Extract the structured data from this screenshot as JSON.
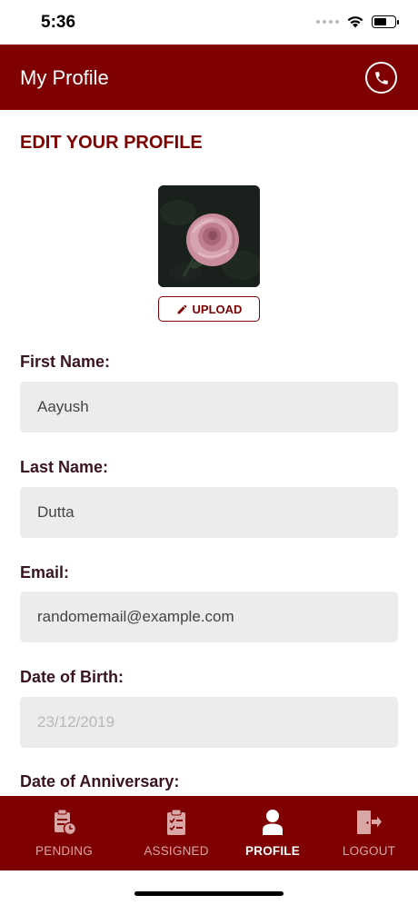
{
  "status_bar": {
    "time": "5:36"
  },
  "app_bar": {
    "title": "My Profile",
    "icon": "phone-icon"
  },
  "profile": {
    "section_title": "EDIT YOUR PROFILE",
    "avatar_description": "rose-photo",
    "upload_label": "UPLOAD",
    "upload_icon": "pencil-icon"
  },
  "fields": {
    "first_name": {
      "label": "First Name:",
      "value": "Aayush"
    },
    "last_name": {
      "label": "Last Name:",
      "value": "Dutta"
    },
    "email": {
      "label": "Email:",
      "value": "randomemail@example.com"
    },
    "dob": {
      "label": "Date of Birth:",
      "value": "23/12/2019"
    },
    "anniversary": {
      "label": "Date of Anniversary:"
    }
  },
  "bottom_nav": [
    {
      "label": "PENDING",
      "icon": "clipboard-clock-icon",
      "active": false
    },
    {
      "label": "ASSIGNED",
      "icon": "clipboard-check-icon",
      "active": false
    },
    {
      "label": "PROFILE",
      "icon": "person-icon",
      "active": true
    },
    {
      "label": "LOGOUT",
      "icon": "logout-icon",
      "active": false
    }
  ],
  "colors": {
    "primary": "#7e0000",
    "field_bg": "#ececec",
    "label": "#3a1520"
  }
}
